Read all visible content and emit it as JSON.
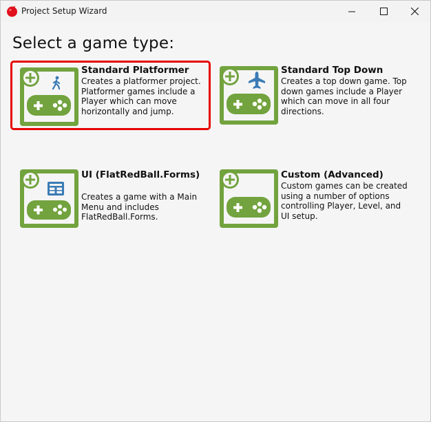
{
  "window": {
    "title": "Project Setup Wizard",
    "controls": {
      "minimize": "minimize-icon",
      "maximize": "maximize-icon",
      "close": "close-icon"
    }
  },
  "heading": "Select a game type:",
  "colors": {
    "icon_green": "#72a33e",
    "icon_blue": "#3a7bb5",
    "selection": "#e60000"
  },
  "options": [
    {
      "title": "Standard Platformer",
      "description": "Creates a platformer project. Platformer games include a Player which can move horizontally and jump.",
      "icon": "platformer-icon",
      "selected": true
    },
    {
      "title": "Standard Top Down",
      "description": "Creates a top down game. Top down games include a Player which can move in all four directions.",
      "icon": "top-down-icon",
      "selected": false
    },
    {
      "title": "UI (FlatRedBall.Forms)",
      "description": "Creates a game with a Main Menu and includes FlatRedBall.Forms.",
      "icon": "ui-forms-icon",
      "selected": false
    },
    {
      "title": "Custom (Advanced)",
      "description": "Custom games can be created using a number of options controlling Player, Level, and UI setup.",
      "icon": "custom-icon",
      "selected": false
    }
  ]
}
